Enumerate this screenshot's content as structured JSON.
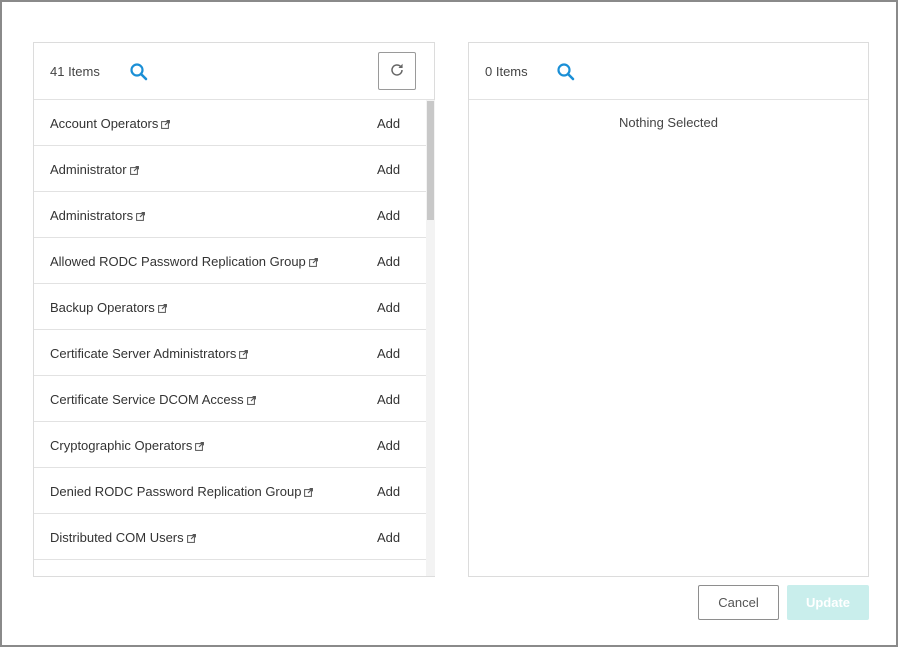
{
  "left_panel": {
    "count_label": "41 Items",
    "items": [
      {
        "name": "Account Operators",
        "action": "Add"
      },
      {
        "name": "Administrator",
        "action": "Add"
      },
      {
        "name": "Administrators",
        "action": "Add"
      },
      {
        "name": "Allowed RODC Password Replication Group",
        "action": "Add"
      },
      {
        "name": "Backup Operators",
        "action": "Add"
      },
      {
        "name": "Certificate Server Administrators",
        "action": "Add"
      },
      {
        "name": "Certificate Service DCOM Access",
        "action": "Add"
      },
      {
        "name": "Cryptographic Operators",
        "action": "Add"
      },
      {
        "name": "Denied RODC Password Replication Group",
        "action": "Add"
      },
      {
        "name": "Distributed COM Users",
        "action": "Add"
      }
    ]
  },
  "right_panel": {
    "count_label": "0 Items",
    "empty_text": "Nothing Selected"
  },
  "footer": {
    "cancel_label": "Cancel",
    "update_label": "Update"
  },
  "icons": {
    "search": "search-icon",
    "refresh": "refresh-icon",
    "external_link": "external-link-icon"
  },
  "colors": {
    "accent": "#1a8fd6",
    "update_disabled_bg": "#c9eeec"
  }
}
